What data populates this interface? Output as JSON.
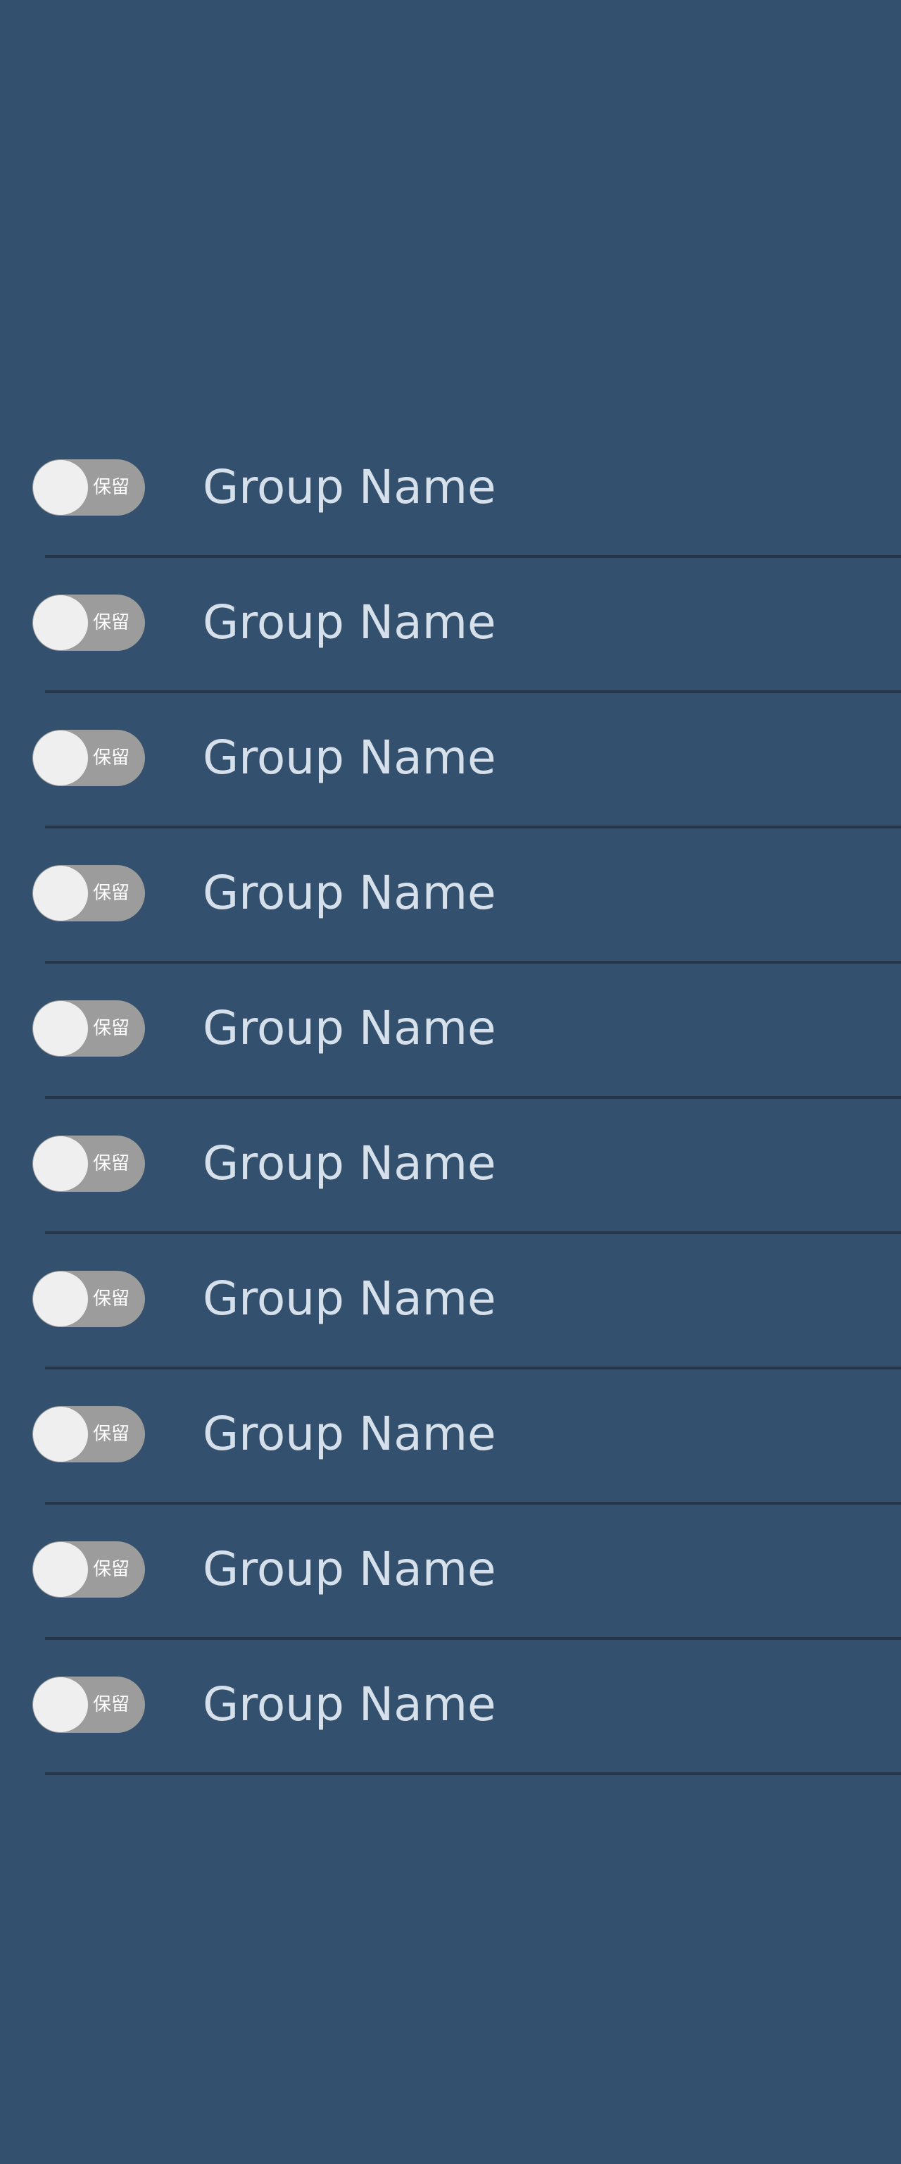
{
  "groups": [
    {
      "name": "Group Name",
      "toggle_label": "保留"
    },
    {
      "name": "Group Name",
      "toggle_label": "保留"
    },
    {
      "name": "Group Name",
      "toggle_label": "保留"
    },
    {
      "name": "Group Name",
      "toggle_label": "保留"
    },
    {
      "name": "Group Name",
      "toggle_label": "保留"
    },
    {
      "name": "Group Name",
      "toggle_label": "保留"
    },
    {
      "name": "Group Name",
      "toggle_label": "保留"
    },
    {
      "name": "Group Name",
      "toggle_label": "保留"
    },
    {
      "name": "Group Name",
      "toggle_label": "保留"
    },
    {
      "name": "Group Name",
      "toggle_label": "保留"
    }
  ],
  "colors": {
    "background": "#33506e",
    "toggle_track": "#9c9c9c",
    "toggle_knob": "#efefef",
    "text": "#d6e0ea",
    "divider": "#26364a"
  }
}
